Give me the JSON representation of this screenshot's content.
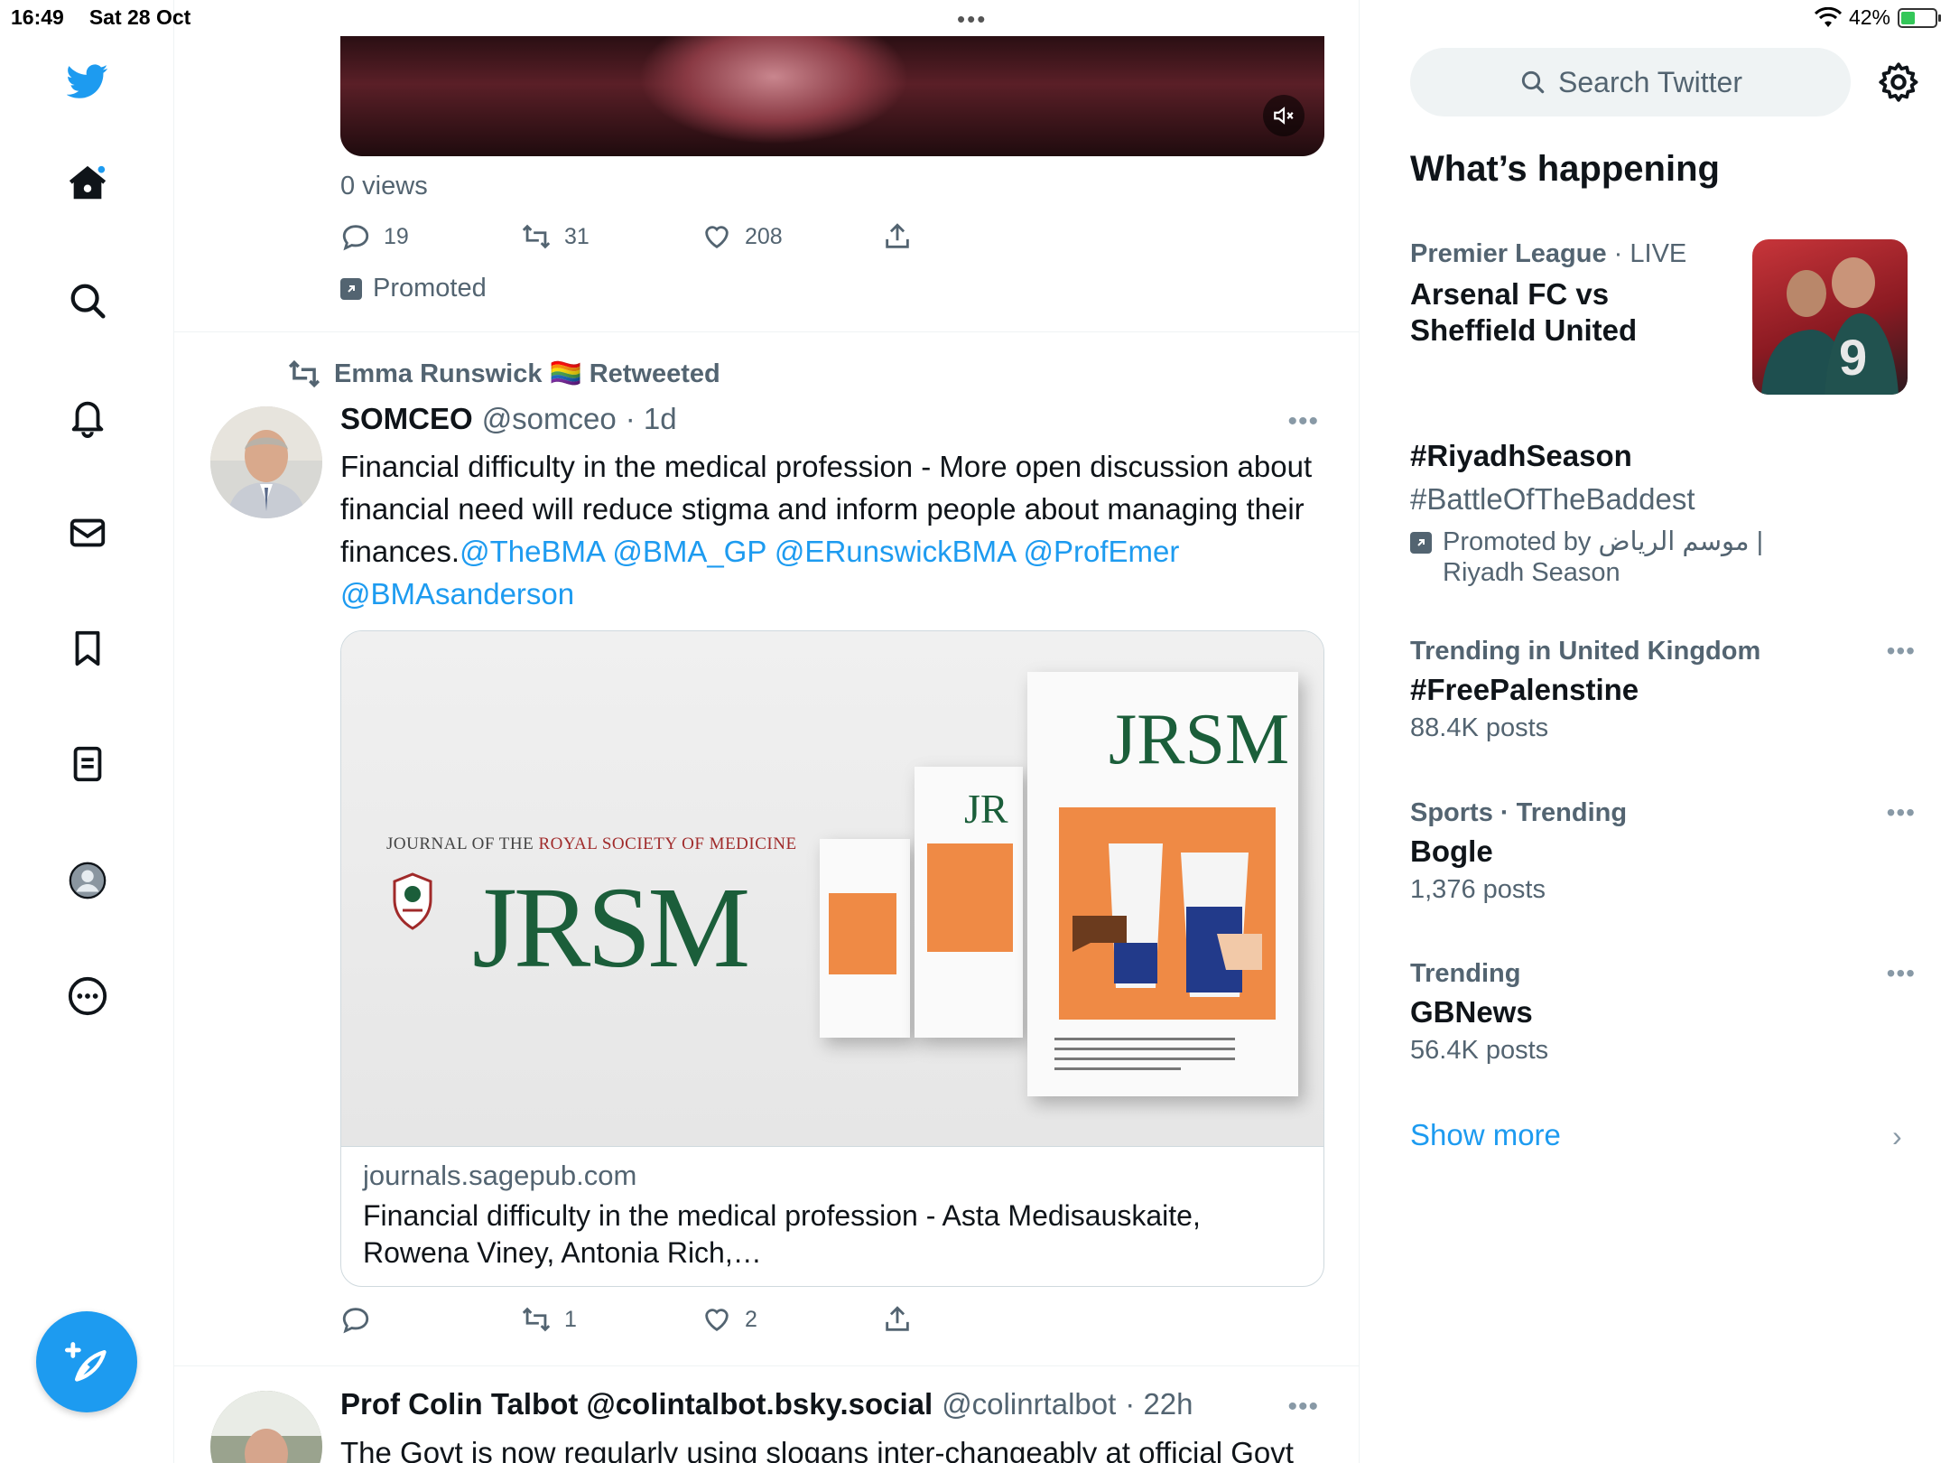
{
  "status_bar": {
    "time": "16:49",
    "date": "Sat 28 Oct",
    "battery": "42%",
    "battery_level": 0.42
  },
  "nav": {
    "items": [
      "twitter-logo",
      "home",
      "explore",
      "notifications",
      "messages",
      "bookmarks",
      "lists",
      "profile",
      "more"
    ]
  },
  "feed": {
    "promoted_tweet": {
      "views": "0 views",
      "reply_count": "19",
      "retweet_count": "31",
      "like_count": "208",
      "promoted_label": "Promoted"
    },
    "tweet": {
      "retweeted_by": "Emma Runswick 🏳️‍🌈 Retweeted",
      "name": "SOMCEO",
      "handle": "@somceo",
      "time": "· 1d",
      "text_plain": "Financial difficulty in the medical profession - More open discussion about financial need will reduce stigma and inform people about managing their finances.",
      "mentions": "@TheBMA @BMA_GP @ERunswickBMA @ProfEmer @BMAsanderson",
      "card": {
        "journal_line_1": "JOURNAL OF THE ",
        "journal_line_2": "ROYAL SOCIETY OF MEDICINE",
        "logo": "JRSM",
        "cover_title": "JRSM",
        "domain": "journals.sagepub.com",
        "title": "Financial difficulty in the medical profession - Asta Medisauskaite, Rowena Viney, Antonia Rich,…"
      },
      "reply_count": "",
      "retweet_count": "1",
      "like_count": "2"
    },
    "next_tweet": {
      "name": "Prof Colin Talbot @colintalbot.bsky.social",
      "handle": "@colinrtalbot",
      "time": "· 22h",
      "text": "The Govt is now regularly using slogans inter-changeably at official Govt"
    }
  },
  "sidebar": {
    "search_placeholder": "Search Twitter",
    "heading": "What’s happening",
    "trends": [
      {
        "context": "Premier League",
        "context_extra": " · LIVE",
        "topic": "Arsenal FC vs Sheffield United"
      },
      {
        "topic": "#RiyadhSeason",
        "subtopic": "#BattleOfTheBaddest",
        "promoted": "Promoted by موسم الرياض | Riyadh Season"
      },
      {
        "context": "Trending in United Kingdom",
        "topic": "#FreePalenstine",
        "count": "88.4K posts"
      },
      {
        "context": "Sports · Trending",
        "topic": "Bogle",
        "count": "1,376 posts"
      },
      {
        "context": "Trending",
        "topic": "GBNews",
        "count": "56.4K posts"
      }
    ],
    "show_more": "Show more"
  },
  "colors": {
    "accent": "#1d9bf0",
    "secondary_text": "#536471",
    "jrsm_green": "#1b5e3a",
    "jrsm_orange": "#ef8a45"
  }
}
